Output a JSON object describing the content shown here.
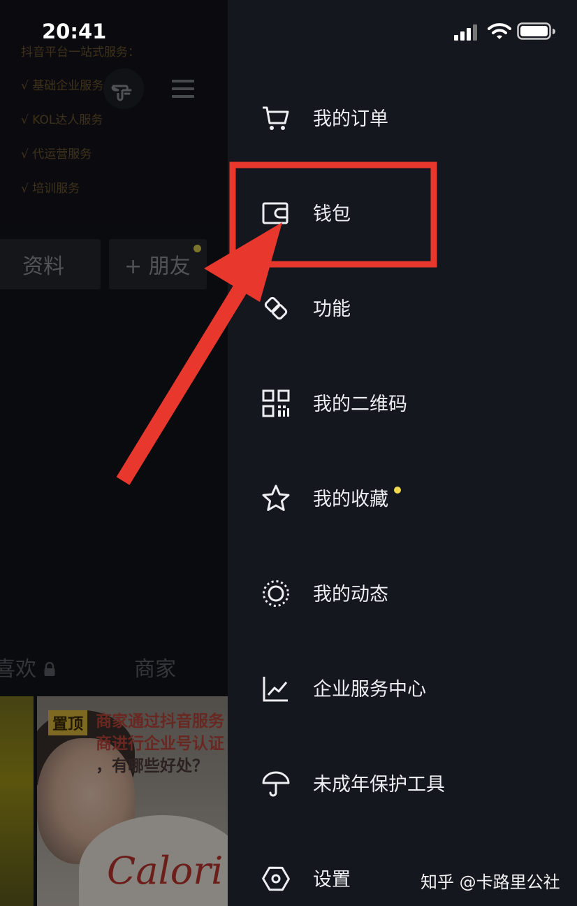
{
  "status_bar": {
    "time": "20:41"
  },
  "profile_page": {
    "services": {
      "title": "抖音平台一站式服务：",
      "items": [
        "√ 基础企业服务",
        "√ KOL达人服务",
        "√ 代运营服务",
        "√ 培训服务"
      ]
    },
    "edit_button_label": "资料",
    "add_friend_label": "+ 朋友",
    "tabs": [
      "喜欢",
      "商家"
    ],
    "video": {
      "pinned_label": "置顶",
      "caption_lines": [
        "商家通过抖音服务",
        "商进行企业号认证",
        "，有哪些好处？"
      ],
      "sign_text": "Calori"
    }
  },
  "drawer": {
    "items": [
      {
        "label": "我的订单",
        "icon": "cart-icon"
      },
      {
        "label": "钱包",
        "icon": "wallet-icon"
      },
      {
        "label": "功能",
        "icon": "function-icon"
      },
      {
        "label": "我的二维码",
        "icon": "qr-code-icon"
      },
      {
        "label": "我的收藏",
        "icon": "star-icon",
        "new_dot": true
      },
      {
        "label": "我的动态",
        "icon": "activity-circle-icon"
      },
      {
        "label": "企业服务中心",
        "icon": "chart-icon"
      },
      {
        "label": "未成年保护工具",
        "icon": "umbrella-icon"
      },
      {
        "label": "设置",
        "icon": "settings-hex-icon"
      }
    ]
  },
  "watermark": "知乎 @卡路里公社",
  "colors": {
    "drawer_bg": "#15171f",
    "annotation_red": "#e8372c",
    "dot_yellow": "#f0d94a"
  }
}
